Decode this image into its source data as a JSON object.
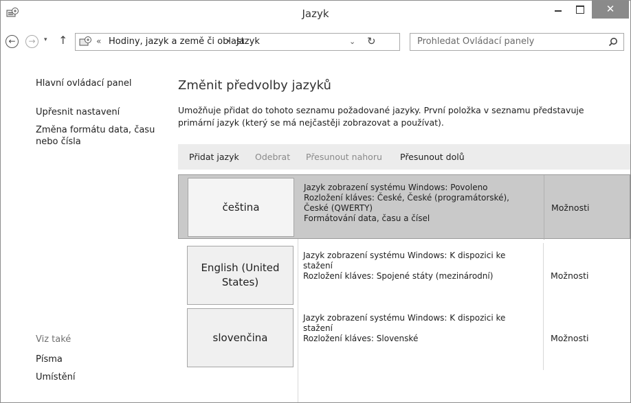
{
  "window": {
    "title": "Jazyk",
    "minimize": "–",
    "close": "✕"
  },
  "nav": {
    "back": "←",
    "forward": "→",
    "up": "↑",
    "history_dropdown": "▾",
    "address": {
      "prefix": "«",
      "crumbs": [
        "Hodiny, jazyk a země či oblast",
        "Jazyk"
      ],
      "separator": "▸",
      "dropdown": "⌄",
      "refresh": "↻"
    },
    "search": {
      "placeholder": "Prohledat Ovládací panely"
    }
  },
  "sidebar": {
    "home": "Hlavní ovládací panel",
    "advanced": "Upřesnit nastavení",
    "format": "Změna formátu data, času nebo čísla",
    "see_also": "Viz také",
    "fonts": "Písma",
    "location": "Umístění"
  },
  "main": {
    "heading": "Změnit předvolby jazyků",
    "description": "Umožňuje přidat do tohoto seznamu požadované jazyky. První položka v seznamu představuje primární jazyk (který se má nejčastěji zobrazovat a používat).",
    "toolbar": {
      "add": "Přidat jazyk",
      "remove": "Odebrat",
      "move_up": "Přesunout nahoru",
      "move_down": "Přesunout dolů"
    },
    "languages": [
      {
        "name": "čeština",
        "details": [
          "Jazyk zobrazení systému Windows: Povoleno",
          "Rozložení kláves: České, České (programátorské),",
          "České (QWERTY)",
          "Formátování data, času a čísel"
        ],
        "options": "Možnosti",
        "selected": true
      },
      {
        "name": "English (United States)",
        "details": [
          "Jazyk zobrazení systému Windows: K dispozici ke",
          "stažení",
          "Rozložení kláves: Spojené státy (mezinárodní)"
        ],
        "options": "Možnosti",
        "selected": false
      },
      {
        "name": "slovenčina",
        "details": [
          "Jazyk zobrazení systému Windows: K dispozici ke",
          "stažení",
          "Rozložení kláves: Slovenské"
        ],
        "options": "Možnosti",
        "selected": false
      }
    ]
  },
  "icons": {
    "app": "control-panel-icon",
    "search": "search-icon",
    "refresh": "refresh-icon"
  }
}
